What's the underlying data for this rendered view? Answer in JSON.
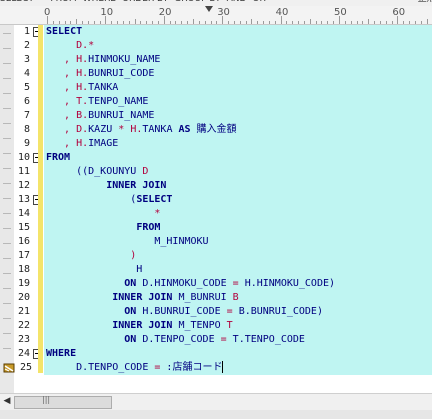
{
  "toolbar": {
    "items": [
      "SELECT",
      "*",
      "FROM",
      "WHERE",
      "ORDER BY",
      "GROUP BY",
      "AND",
      "OR",
      "",
      "整形"
    ]
  },
  "ruler": {
    "marks": [
      "0",
      "10",
      "20",
      "30",
      "40",
      "50",
      "60"
    ]
  },
  "gutter": {
    "line_numbers": [
      "1",
      "2",
      "3",
      "4",
      "5",
      "6",
      "7",
      "8",
      "9",
      "10",
      "11",
      "12",
      "13",
      "14",
      "15",
      "16",
      "17",
      "18",
      "19",
      "20",
      "21",
      "22",
      "23",
      "24",
      "25"
    ]
  },
  "editor": {
    "lines": [
      [
        {
          "t": "SELECT",
          "c": "kw"
        }
      ],
      [
        {
          "t": "     ",
          "c": "id"
        },
        {
          "t": "D.*",
          "c": "alias"
        }
      ],
      [
        {
          "t": "   , ",
          "c": "op"
        },
        {
          "t": "H.",
          "c": "alias"
        },
        {
          "t": "HINMOKU_NAME",
          "c": "id"
        }
      ],
      [
        {
          "t": "   , ",
          "c": "op"
        },
        {
          "t": "H.",
          "c": "alias"
        },
        {
          "t": "BUNRUI_CODE",
          "c": "id"
        }
      ],
      [
        {
          "t": "   , ",
          "c": "op"
        },
        {
          "t": "H.",
          "c": "alias"
        },
        {
          "t": "TANKA",
          "c": "id"
        }
      ],
      [
        {
          "t": "   , ",
          "c": "op"
        },
        {
          "t": "T.",
          "c": "alias"
        },
        {
          "t": "TENPO_NAME",
          "c": "id"
        }
      ],
      [
        {
          "t": "   , ",
          "c": "op"
        },
        {
          "t": "B.",
          "c": "alias"
        },
        {
          "t": "BUNRUI_NAME",
          "c": "id"
        }
      ],
      [
        {
          "t": "   , ",
          "c": "op"
        },
        {
          "t": "D.",
          "c": "alias"
        },
        {
          "t": "KAZU ",
          "c": "id"
        },
        {
          "t": "* ",
          "c": "op"
        },
        {
          "t": "H.",
          "c": "alias"
        },
        {
          "t": "TANKA ",
          "c": "id"
        },
        {
          "t": "AS ",
          "c": "kw"
        },
        {
          "t": "購入金額",
          "c": "id"
        }
      ],
      [
        {
          "t": "   , ",
          "c": "op"
        },
        {
          "t": "H.",
          "c": "alias"
        },
        {
          "t": "IMAGE",
          "c": "id"
        }
      ],
      [
        {
          "t": "FROM",
          "c": "kw"
        }
      ],
      [
        {
          "t": "     ((D_KOUNYU ",
          "c": "id"
        },
        {
          "t": "D",
          "c": "alias"
        }
      ],
      [
        {
          "t": "          ",
          "c": "id"
        },
        {
          "t": "INNER JOIN",
          "c": "kw"
        }
      ],
      [
        {
          "t": "              (",
          "c": "id"
        },
        {
          "t": "SELECT",
          "c": "kw"
        }
      ],
      [
        {
          "t": "                  ",
          "c": "id"
        },
        {
          "t": "*",
          "c": "op"
        }
      ],
      [
        {
          "t": "               ",
          "c": "id"
        },
        {
          "t": "FROM",
          "c": "kw"
        }
      ],
      [
        {
          "t": "                  M_HINMOKU",
          "c": "id"
        }
      ],
      [
        {
          "t": "              ",
          "c": "id"
        },
        {
          "t": ")",
          "c": "op"
        }
      ],
      [
        {
          "t": "               H",
          "c": "id"
        }
      ],
      [
        {
          "t": "             ",
          "c": "id"
        },
        {
          "t": "ON ",
          "c": "kw"
        },
        {
          "t": "D.HINMOKU_CODE ",
          "c": "id"
        },
        {
          "t": "= ",
          "c": "op"
        },
        {
          "t": "H.HINMOKU_CODE)",
          "c": "id"
        }
      ],
      [
        {
          "t": "           ",
          "c": "id"
        },
        {
          "t": "INNER JOIN ",
          "c": "kw"
        },
        {
          "t": "M_BUNRUI ",
          "c": "id"
        },
        {
          "t": "B",
          "c": "alias"
        }
      ],
      [
        {
          "t": "             ",
          "c": "id"
        },
        {
          "t": "ON ",
          "c": "kw"
        },
        {
          "t": "H.BUNRUI_CODE ",
          "c": "id"
        },
        {
          "t": "= ",
          "c": "op"
        },
        {
          "t": "B.BUNRUI_CODE)",
          "c": "id"
        }
      ],
      [
        {
          "t": "           ",
          "c": "id"
        },
        {
          "t": "INNER JOIN ",
          "c": "kw"
        },
        {
          "t": "M_TENPO ",
          "c": "id"
        },
        {
          "t": "T",
          "c": "alias"
        }
      ],
      [
        {
          "t": "             ",
          "c": "id"
        },
        {
          "t": "ON ",
          "c": "kw"
        },
        {
          "t": "D.TENPO_CODE ",
          "c": "id"
        },
        {
          "t": "= ",
          "c": "op"
        },
        {
          "t": "T.TENPO_CODE",
          "c": "id"
        }
      ],
      [
        {
          "t": "WHERE",
          "c": "kw"
        }
      ],
      [
        {
          "t": "     D.TENPO_CODE ",
          "c": "id"
        },
        {
          "t": "= ",
          "c": "op"
        },
        {
          "t": ":店舗コード",
          "c": "id"
        }
      ]
    ]
  },
  "colors": {
    "editor_background": "#bff5f2",
    "modified_bar": "#f4e46a",
    "keyword": "#000080",
    "alias": "#b2003c"
  },
  "icons": {
    "bookmark": "bookmark-icon",
    "fold": "fold-toggle-icon",
    "scroll_left": "scroll-left-arrow-icon"
  },
  "scrollbar": {
    "left_arrow": "◀",
    "grip": "|||"
  }
}
